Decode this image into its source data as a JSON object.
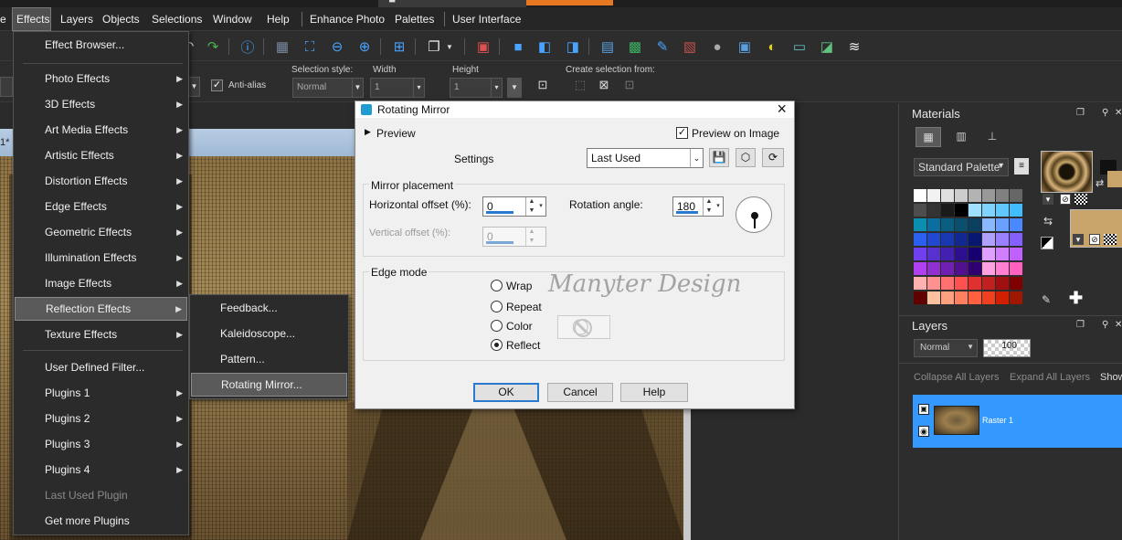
{
  "menubar": {
    "items": [
      "Effects",
      "Layers",
      "Objects",
      "Selections",
      "Window",
      "Help",
      "Enhance Photo",
      "Palettes",
      "User Interface"
    ]
  },
  "optbar": {
    "antialias_label": "Anti-alias",
    "selection_style_label": "Selection style:",
    "selection_style_value": "Normal",
    "width_label": "Width",
    "width_value": "1",
    "height_label": "Height",
    "height_value": "1",
    "create_selection_label": "Create selection from:"
  },
  "canvas": {
    "doc_tab": "1*"
  },
  "effects_menu": {
    "items": [
      {
        "label": "Effect Browser..."
      },
      {
        "label": "Photo Effects"
      },
      {
        "label": "3D Effects"
      },
      {
        "label": "Art Media Effects"
      },
      {
        "label": "Artistic Effects"
      },
      {
        "label": "Distortion Effects"
      },
      {
        "label": "Edge Effects"
      },
      {
        "label": "Geometric Effects"
      },
      {
        "label": "Illumination Effects"
      },
      {
        "label": "Image Effects"
      },
      {
        "label": "Reflection Effects"
      },
      {
        "label": "Texture Effects"
      },
      {
        "label": "User Defined Filter..."
      },
      {
        "label": "Plugins 1"
      },
      {
        "label": "Plugins 2"
      },
      {
        "label": "Plugins 3"
      },
      {
        "label": "Plugins 4"
      },
      {
        "label": "Last Used Plugin"
      },
      {
        "label": "Get more Plugins"
      }
    ]
  },
  "reflection_menu": {
    "items": [
      {
        "label": "Feedback..."
      },
      {
        "label": "Kaleidoscope..."
      },
      {
        "label": "Pattern..."
      },
      {
        "label": "Rotating Mirror..."
      }
    ]
  },
  "dialog": {
    "title": "Rotating Mirror",
    "preview_label": "Preview",
    "preview_on_image_label": "Preview on Image",
    "settings_label": "Settings",
    "settings_value": "Last Used",
    "mirror_placement_label": "Mirror placement",
    "horizontal_offset_label": "Horizontal offset (%):",
    "horizontal_offset_value": "0",
    "vertical_offset_label": "Vertical offset (%):",
    "vertical_offset_value": "0",
    "rotation_angle_label": "Rotation angle:",
    "rotation_angle_value": "180",
    "edge_mode_label": "Edge mode",
    "edge_modes": [
      "Wrap",
      "Repeat",
      "Color",
      "Reflect"
    ],
    "edge_mode_selected": "Reflect",
    "ok_label": "OK",
    "cancel_label": "Cancel",
    "help_label": "Help"
  },
  "watermark": "Manyter Design",
  "materials": {
    "title": "Materials",
    "palette_value": "Standard Palette"
  },
  "layers": {
    "title": "Layers",
    "blend_mode": "Normal",
    "opacity": "100",
    "collapse_label": "Collapse All Layers",
    "expand_label": "Expand All Layers",
    "show_label": "Show",
    "layer_name": "Raster 1"
  },
  "colors": {
    "accent": "#3399ff",
    "orange_strip": "#e87722"
  }
}
